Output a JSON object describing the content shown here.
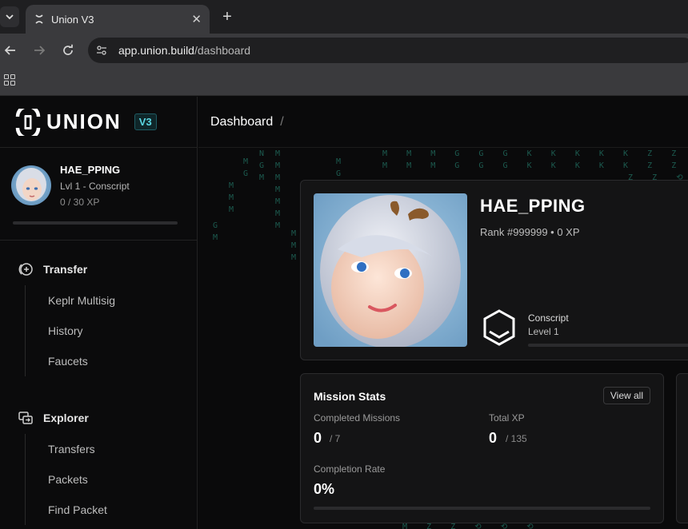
{
  "browser": {
    "tab_title": "Union V3",
    "url_host": "app.union.build",
    "url_path": "/dashboard",
    "new_tab_label": "+",
    "close_label": "✕"
  },
  "sidebar": {
    "logo_text": "UNION",
    "version_badge": "V3",
    "user": {
      "name": "HAE_PPING",
      "level": "Lvl 1 - Conscript",
      "xp": "0 / 30 XP",
      "xp_progress": 0
    },
    "sections": [
      {
        "label": "Transfer",
        "icon": "transfer-icon",
        "items": [
          "Keplr Multisig",
          "History",
          "Faucets"
        ]
      },
      {
        "label": "Explorer",
        "icon": "explorer-icon",
        "items": [
          "Transfers",
          "Packets",
          "Find Packet"
        ]
      }
    ]
  },
  "main": {
    "breadcrumb": "Dashboard",
    "breadcrumb_sep": "/",
    "profile": {
      "name": "HAE_PPING",
      "rank_line": "Rank #999999 • 0 XP",
      "rank_title": "Conscript",
      "rank_level": "Level 1",
      "level_progress": 0
    },
    "mission_stats": {
      "title": "Mission Stats",
      "view_all": "View all",
      "completed_label": "Completed Missions",
      "completed_value": "0",
      "completed_total": "/ 7",
      "xp_label": "Total XP",
      "xp_value": "0",
      "xp_total": "/ 135",
      "rate_label": "Completion Rate",
      "rate_value": "0%",
      "rate_progress": 0
    }
  },
  "colors": {
    "accent_cyan": "#5ad6e2",
    "matrix_green": "#1c5a4f",
    "card_bg": "#141415"
  }
}
